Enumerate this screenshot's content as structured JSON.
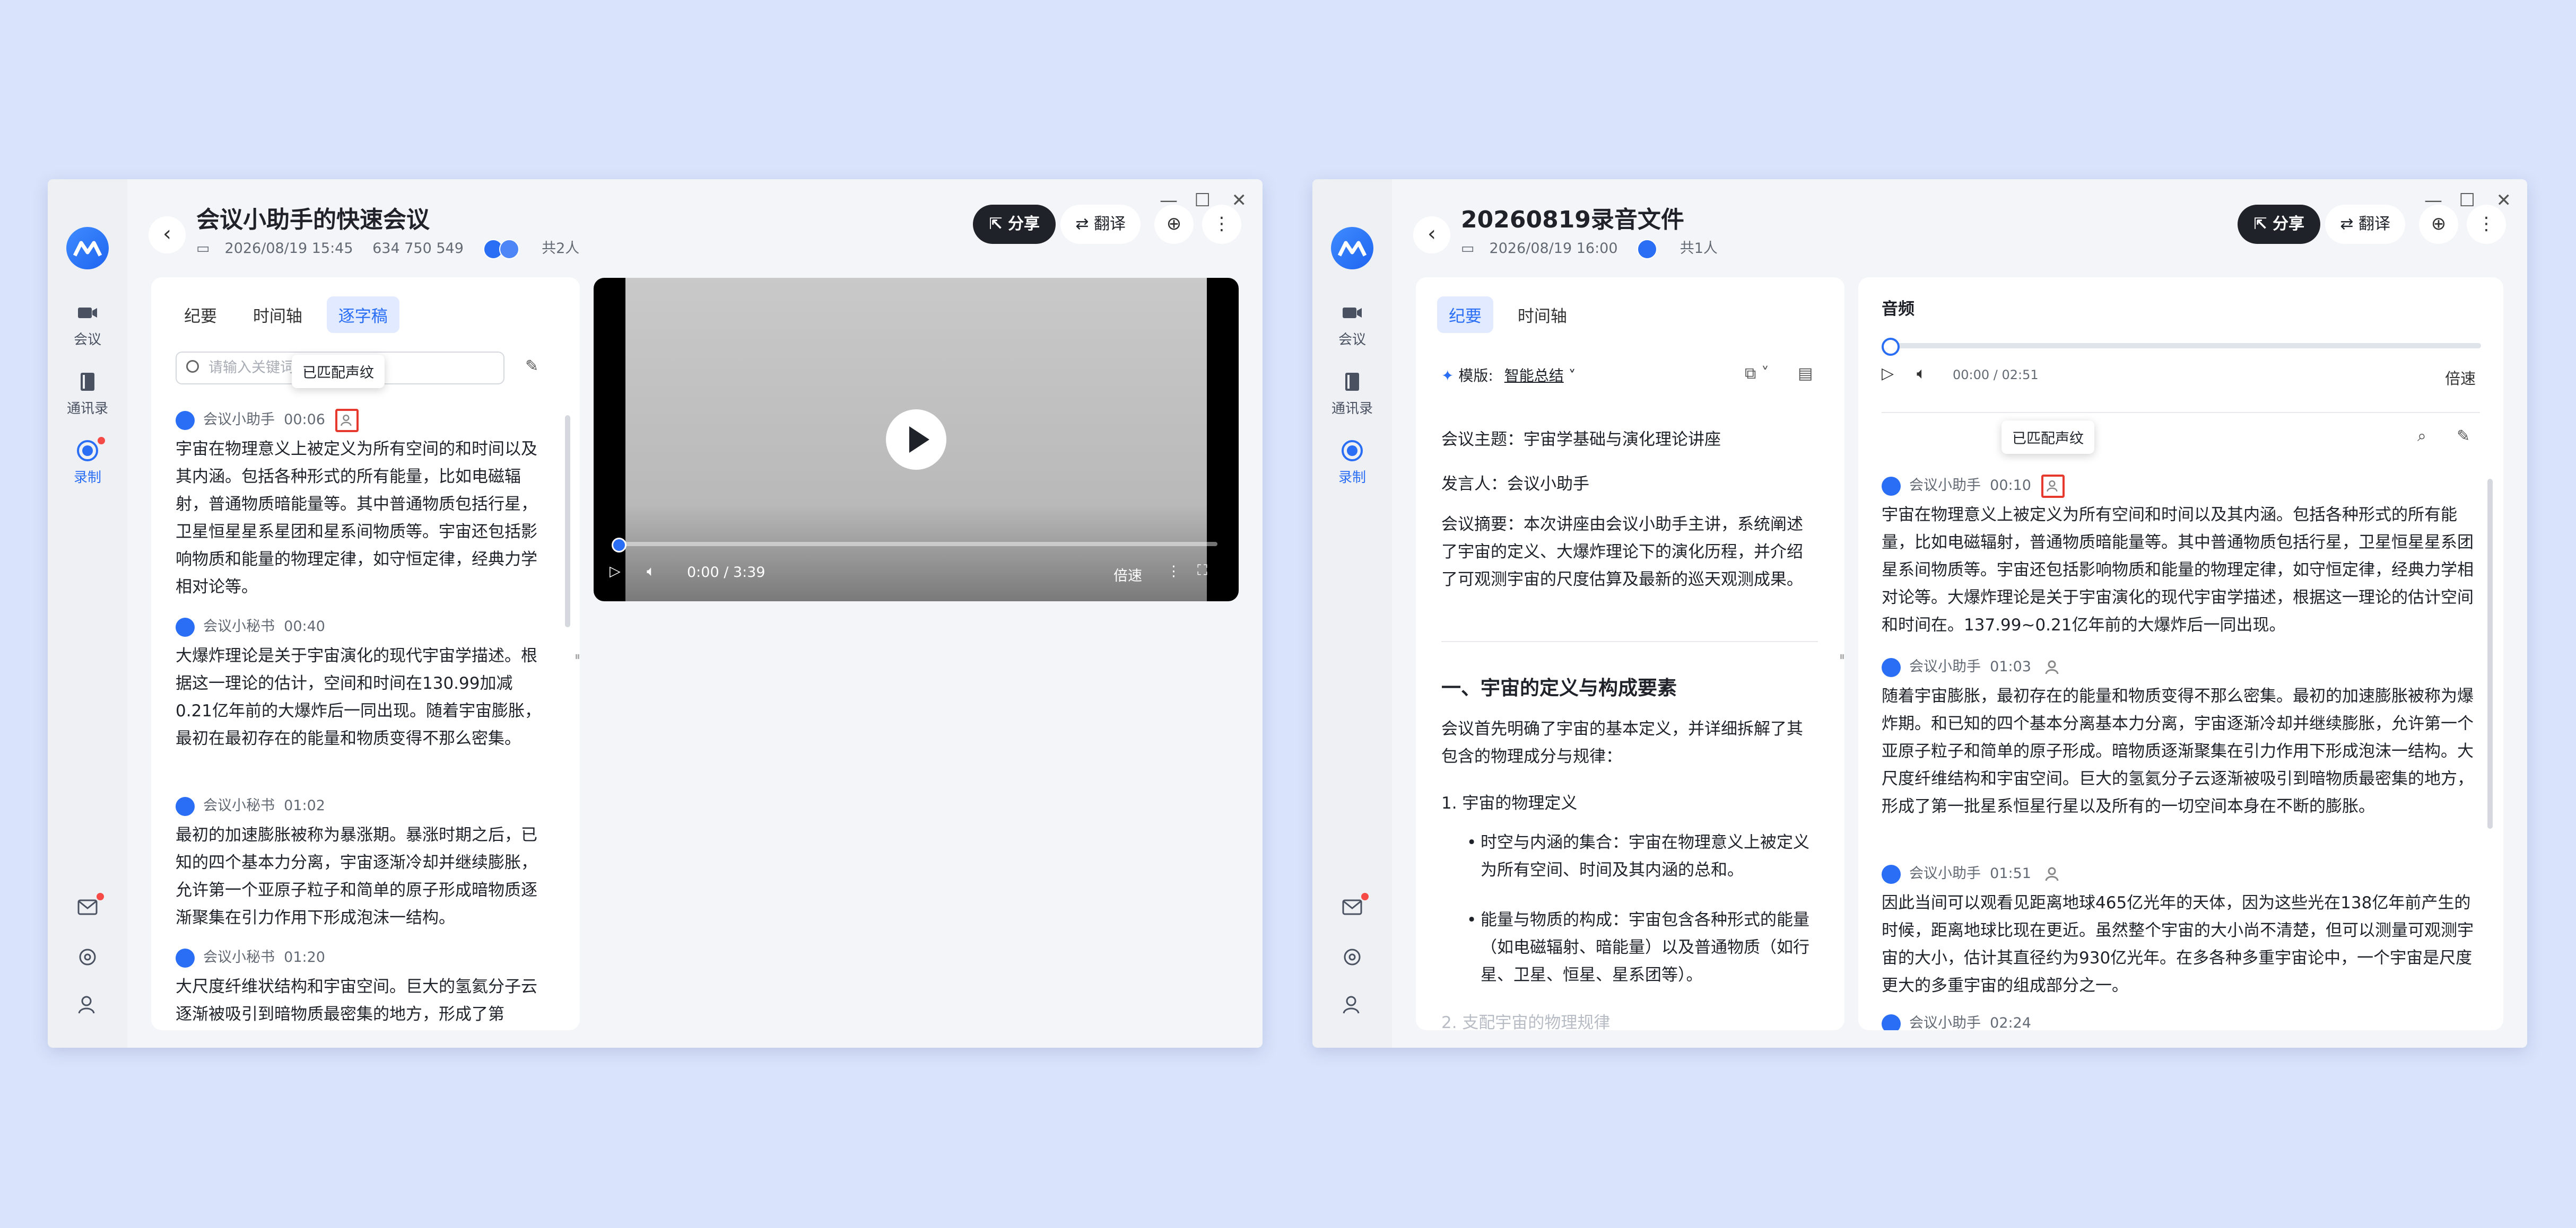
{
  "left_window": {
    "title": "会议小助手的快速会议",
    "date": "2026/08/19 15:45",
    "meeting_id": "634 750 549",
    "participants": "共2人",
    "share_label": "分享",
    "translate_label": "翻译",
    "tabs": [
      "纪要",
      "时间轴",
      "逐字稿"
    ],
    "selected_tab": "逐字稿",
    "search_placeholder": "请输入关键词",
    "tooltip": "已匹配声纹",
    "transcript": [
      {
        "speaker": "会议小助手",
        "time": "00:06",
        "text": "宇宙在物理意义上被定义为所有空间的和时间以及其内涵。包括各种形式的所有能量，比如电磁辐射，普通物质暗能量等。其中普通物质包括行星，卫星恒星星系星团和星系间物质等。宇宙还包括影响物质和能量的物理定律，如守恒定律，经典力学相对论等。"
      },
      {
        "speaker": "会议小秘书",
        "time": "00:40",
        "text": "大爆炸理论是关于宇宙演化的现代宇宙学描述。根据这一理论的估计，空间和时间在130.99加减0.21亿年前的大爆炸后一同出现。随着宇宙膨胀，最初在最初存在的能量和物质变得不那么密集。"
      },
      {
        "speaker": "会议小秘书",
        "time": "01:02",
        "text": "最初的加速膨胀被称为暴涨期。暴涨时期之后，已知的四个基本力分离，宇宙逐渐冷却并继续膨胀，允许第一个亚原子粒子和简单的原子形成暗物质逐渐聚集在引力作用下形成泡沫一结构。"
      },
      {
        "speaker": "会议小秘书",
        "time": "01:20",
        "text": "大尺度纤维状结构和宇宙空间。巨大的氢氦分子云逐渐被吸引到暗物质最密集的地方，形成了第"
      }
    ],
    "video": {
      "time": "0:00 / 3:39",
      "speed": "倍速"
    }
  },
  "right_window": {
    "title": "20260819录音文件",
    "date": "2026/08/19 16:00",
    "participants": "共1人",
    "share_label": "分享",
    "translate_label": "翻译",
    "tabs": [
      "纪要",
      "时间轴"
    ],
    "selected_tab": "纪要",
    "template_label": "模版:",
    "template_value": "智能总结",
    "summary": {
      "topic": "会议主题：宇宙学基础与演化理论讲座",
      "speaker": "发言人：会议小助手",
      "abstract": "会议摘要：本次讲座由会议小助手主讲，系统阐述了宇宙的定义、大爆炸理论下的演化历程，并介绍了可观测宇宙的尺度估算及最新的巡天观测成果。",
      "section1": "一、宇宙的定义与构成要素",
      "section1_intro": "会议首先明确了宇宙的基本定义，并详细拆解了其包含的物理成分与规律：",
      "sub1": "1. 宇宙的物理定义",
      "bullets": [
        "时空与内涵的集合：宇宙在物理意义上被定义为所有空间、时间及其内涵的总和。",
        "能量与物质的构成：宇宙包含各种形式的能量（如电磁辐射、暗能量）以及普通物质（如行星、卫星、恒星、星系团等）。"
      ],
      "sub2": "2. 支配宇宙的物理规律"
    },
    "audio": {
      "label": "音频",
      "time": "00:00 / 02:51",
      "speed": "倍速"
    },
    "tooltip": "已匹配声纹",
    "transcript": [
      {
        "speaker": "会议小助手",
        "time": "00:10",
        "text": "宇宙在物理意义上被定义为所有空间和时间以及其内涵。包括各种形式的所有能量，比如电磁辐射，普通物质暗能量等。其中普通物质包括行星，卫星恒星星系团星系间物质等。宇宙还包括影响物质和能量的物理定律，如守恒定律，经典力学相对论等。大爆炸理论是关于宇宙演化的现代宇宙学描述，根据这一理论的估计空间和时间在。137.99~0.21亿年前的大爆炸后一同出现。"
      },
      {
        "speaker": "会议小助手",
        "time": "01:03",
        "text": "随着宇宙膨胀，最初存在的能量和物质变得不那么密集。最初的加速膨胀被称为爆炸期。和已知的四个基本分离基本力分离，宇宙逐渐冷却并继续膨胀，允许第一个亚原子粒子和简单的原子形成。暗物质逐渐聚集在引力作用下形成泡沫一结构。大尺度纤维结构和宇宙空间。巨大的氢氦分子云逐渐被吸引到暗物质最密集的地方，形成了第一批星系恒星行星以及所有的一切空间本身在不断的膨胀。"
      },
      {
        "speaker": "会议小助手",
        "time": "01:51",
        "text": "因此当间可以观看见距离地球465亿光年的天体，因为这些光在138亿年前产生的时候，距离地球比现在更近。虽然整个宇宙的大小尚不清楚，但可以测量可观测宇宙的大小，估计其直径约为930亿光年。在多各种多重宇宙论中，一个宇宙是尺度更大的多重宇宙的组成部分之一。"
      },
      {
        "speaker": "会议小助手",
        "time": "02:24",
        "text": ""
      }
    ]
  },
  "rail": {
    "items": [
      "会议",
      "通讯录",
      "录制"
    ],
    "active": "录制"
  },
  "colors": {
    "accent": "#2a6ef5",
    "background": "#d9e3fb",
    "highlight_box": "#e5392d"
  }
}
